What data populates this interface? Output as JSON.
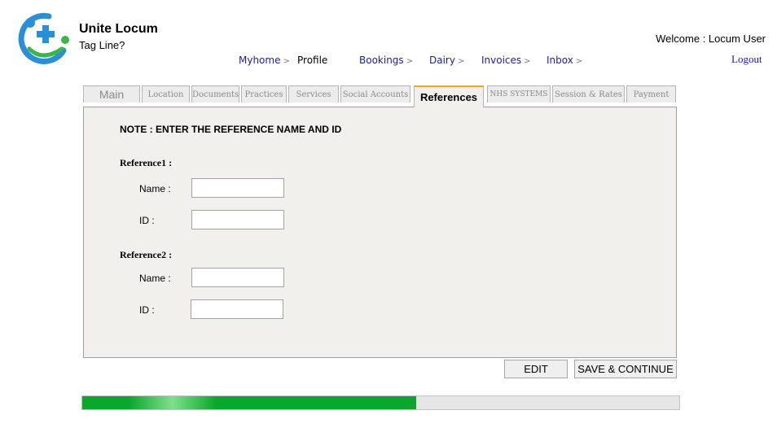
{
  "header": {
    "brand_name": "Unite Locum",
    "tag_line": "Tag Line?",
    "welcome": "Welcome : Locum User",
    "logout": "Logout"
  },
  "topnav": [
    {
      "label": "Myhome",
      "chevron": ">"
    },
    {
      "label": "Profile",
      "chevron": ""
    },
    {
      "label": "Bookings",
      "chevron": ">"
    },
    {
      "label": "Dairy",
      "chevron": ">"
    },
    {
      "label": "Invoices",
      "chevron": ">"
    },
    {
      "label": "Inbox",
      "chevron": ">"
    }
  ],
  "tabs": [
    {
      "label": "Main"
    },
    {
      "label": "Location"
    },
    {
      "label": "Documents"
    },
    {
      "label": "Practices"
    },
    {
      "label": "Services"
    },
    {
      "label": "Social Accounts"
    },
    {
      "label": "References",
      "active": true
    },
    {
      "label": "NHS SYSTEMS"
    },
    {
      "label": "Session & Rates"
    },
    {
      "label": "Payment"
    }
  ],
  "form": {
    "note": "NOTE : ENTER THE REFERENCE NAME AND ID",
    "reference1": {
      "heading": "Reference1  :",
      "name_label": "Name   :",
      "id_label": "ID   :",
      "name_value": "",
      "id_value": ""
    },
    "reference2": {
      "heading": "Reference2   :",
      "name_label": "Name   :",
      "id_label": "ID   :",
      "name_value": "",
      "id_value": ""
    }
  },
  "buttons": {
    "edit": "EDIT",
    "save_continue": "SAVE & CONTINUE"
  },
  "progress": {
    "fraction": 0.56
  },
  "colors": {
    "link": "#1a1ab8",
    "active_tab_accent": "#f5a623",
    "progress": "#0aa82a",
    "logo_blue": "#2a8fd6",
    "logo_green": "#39b54a"
  }
}
